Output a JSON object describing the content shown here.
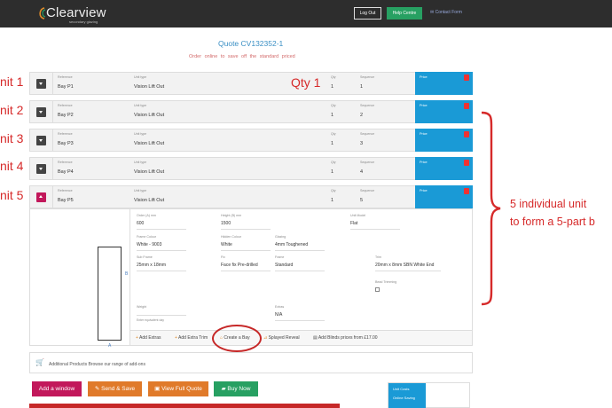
{
  "header": {
    "brand": "Clearview",
    "brand_sub": "secondary glazing",
    "logout_label": "Log Out",
    "help_label": "Help Centre",
    "contact_label": "Contact Form"
  },
  "quote": {
    "label": "Quote",
    "number": "CV132352-1",
    "subtitle": "Order online to save  off the standard priced"
  },
  "columns": {
    "reference": "Reference",
    "unit_type": "Unit type",
    "qty": "Qty",
    "sequence": "Sequence",
    "price": "Price"
  },
  "units": [
    {
      "reference": "Bay P1",
      "unit_type": "Vision Lift Out",
      "qty": "1",
      "sequence": "1"
    },
    {
      "reference": "Bay P2",
      "unit_type": "Vision Lift Out",
      "qty": "1",
      "sequence": "2"
    },
    {
      "reference": "Bay P3",
      "unit_type": "Vision Lift Out",
      "qty": "1",
      "sequence": "3"
    },
    {
      "reference": "Bay P4",
      "unit_type": "Vision Lift Out",
      "qty": "1",
      "sequence": "4"
    },
    {
      "reference": "Bay P5",
      "unit_type": "Vision Lift Out",
      "qty": "1",
      "sequence": "5"
    }
  ],
  "annotations": {
    "unit_labels": [
      "nit 1",
      "nit 2",
      "nit 3",
      "nit 4",
      "nit 5"
    ],
    "qty_note": "Qty 1",
    "side_note_line1": "5 individual unit",
    "side_note_line2": "to form a 5-part b"
  },
  "details": {
    "diagram_b": "B",
    "diagram_a": "A",
    "fields": {
      "order_width": {
        "label": "Order (A) mm",
        "value": "600"
      },
      "height": {
        "label": "Height (B) mm",
        "value": "1500"
      },
      "unit_model": {
        "label": "Unit Model",
        "value": "Flat"
      },
      "frame_colour": {
        "label": "Frame Colour",
        "value": "White - 9003"
      },
      "hidden_colour": {
        "label": "Hidden Colour",
        "value": "White"
      },
      "glazing": {
        "label": "Glazing",
        "value": "4mm Toughened"
      },
      "sub_frame": {
        "label": "Sub Frame",
        "value": "25mm x 18mm"
      },
      "fix": {
        "label": "Fix",
        "value": "Face fix Pre-drilled"
      },
      "frame": {
        "label": "Frame",
        "value": "Standard"
      },
      "trim": {
        "label": "Trim",
        "value": "20mm x 8mm SBN White End"
      },
      "bead_trimming": {
        "label": "Bead Trimming"
      },
      "weight": {
        "label": "Weight",
        "hint": "Enter equivalent day"
      },
      "extras": {
        "label": "Extras",
        "value": "N/A"
      }
    },
    "extras_bar": {
      "add_extras": "Add Extras",
      "add_extra_trim": "Add Extra Trim",
      "create_bay": "Create a Bay",
      "splayed_reveal": "Splayed Reveal",
      "add_blinds": "Add Blinds prices from £17.00"
    }
  },
  "additional": {
    "text": "Additional Products Browse our range of add-ons"
  },
  "actions": {
    "add_window": "Add a window",
    "send_save": "Send & Save",
    "view_full": "View Full Quote",
    "buy_now": "Buy Now"
  },
  "costs": {
    "unit_costs": "Unit Costs",
    "online_saving": "Online Saving"
  },
  "colors": {
    "header_bg": "#2d2d2d",
    "accent_blue": "#1a9ad6",
    "green": "#27a062",
    "pink": "#c2185b",
    "orange": "#e07a2a",
    "annotation_red": "#d62a2a"
  }
}
